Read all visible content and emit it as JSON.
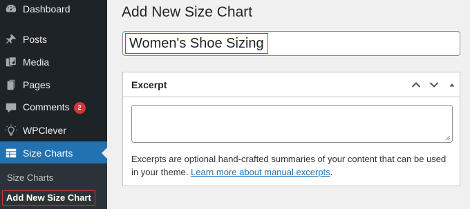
{
  "sidebar": {
    "items": [
      {
        "label": "Dashboard",
        "icon": "dashboard-icon"
      },
      {
        "label": "Posts",
        "icon": "pushpin-icon"
      },
      {
        "label": "Media",
        "icon": "media-icon"
      },
      {
        "label": "Pages",
        "icon": "pages-icon"
      },
      {
        "label": "Comments",
        "icon": "comment-icon",
        "badge": "2"
      },
      {
        "label": "WPClever",
        "icon": "lightbulb-icon"
      },
      {
        "label": "Size Charts",
        "icon": "table-icon",
        "current": true
      }
    ],
    "submenu": [
      {
        "label": "Size Charts"
      },
      {
        "label": "Add New Size Chart",
        "active": true
      }
    ]
  },
  "main": {
    "title": "Add New Size Chart",
    "title_input_value": "Women's Shoe Sizing",
    "excerpt": {
      "title": "Excerpt",
      "textarea_value": "",
      "help_text": "Excerpts are optional hand-crafted summaries of your content that can be used in your theme.",
      "help_link": "Learn more about manual excerpts",
      "help_end": "."
    }
  },
  "colors": {
    "sidebar_bg": "#1d2327",
    "submenu_bg": "#2c3338",
    "accent": "#2271b1",
    "badge": "#d63638",
    "highlight_border": "#d63638",
    "page_bg": "#f0f0f1"
  }
}
